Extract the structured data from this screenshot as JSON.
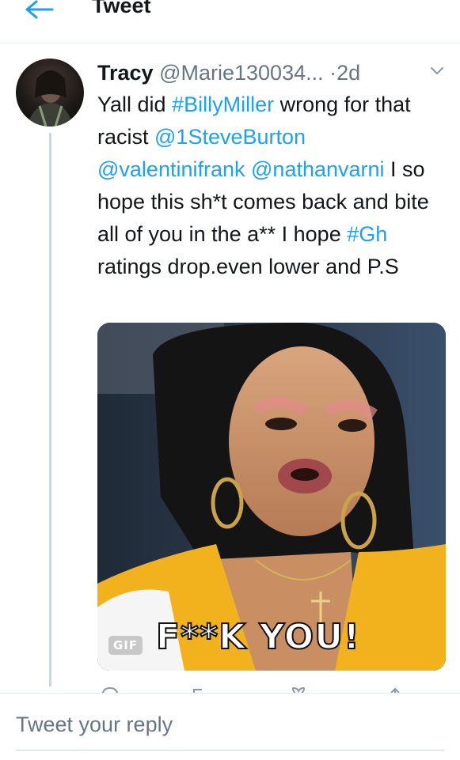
{
  "header": {
    "back_icon": "arrow-left-icon",
    "title": "Tweet"
  },
  "tweet": {
    "author_name": "Tracy",
    "author_handle": "@Marie130034...",
    "separator": "·",
    "time": "2d",
    "menu_icon": "chevron-down-icon",
    "text": {
      "t1": "Yall did ",
      "hashtag1": "#BillyMiller",
      "t2": " wrong for that racist ",
      "mention1": "@1SteveBurton",
      "t3": " ",
      "mention2": "@valentinifrank",
      "t4": " ",
      "mention3": "@nathanvarni",
      "t5": " I so hope this sh*t comes back and bite all of you in the a** I hope ",
      "hashtag2": "#Gh",
      "t6": " ratings drop.even lower and P.S"
    },
    "media": {
      "badge": "GIF",
      "caption": "F**K YOU!"
    },
    "actions": [
      "reply-icon",
      "retweet-icon",
      "like-icon",
      "share-icon"
    ]
  },
  "reply": {
    "placeholder": "Tweet your reply"
  },
  "colors": {
    "link": "#1da1f2",
    "muted": "#657786",
    "divider": "#e6ecf0"
  }
}
